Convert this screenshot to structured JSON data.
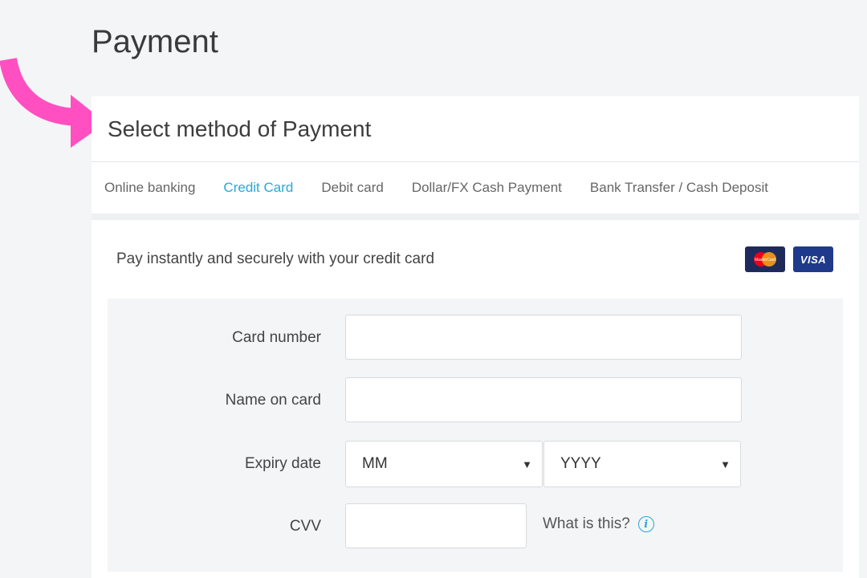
{
  "page": {
    "title": "Payment"
  },
  "panel": {
    "heading": "Select method of Payment"
  },
  "tabs": [
    {
      "label": "Online banking"
    },
    {
      "label": "Credit Card"
    },
    {
      "label": "Debit card"
    },
    {
      "label": "Dollar/FX Cash Payment"
    },
    {
      "label": "Bank Transfer / Cash Deposit"
    }
  ],
  "active_tab": "Credit Card",
  "intro": {
    "text": "Pay instantly and securely with your credit card",
    "logos": {
      "mastercard": "MasterCard",
      "visa": "VISA"
    }
  },
  "form": {
    "card_number": {
      "label": "Card number",
      "value": ""
    },
    "name_on_card": {
      "label": "Name on card",
      "value": ""
    },
    "expiry": {
      "label": "Expiry date",
      "month": "MM",
      "year": "YYYY"
    },
    "cvv": {
      "label": "CVV",
      "value": "",
      "help": "What is this?"
    }
  },
  "colors": {
    "accent": "#28a8d6",
    "arrow": "#ff4fc1"
  },
  "icons": {
    "arrow": "arrow-annotation-icon",
    "info": "info-icon",
    "caret": "chevron-down-icon"
  }
}
